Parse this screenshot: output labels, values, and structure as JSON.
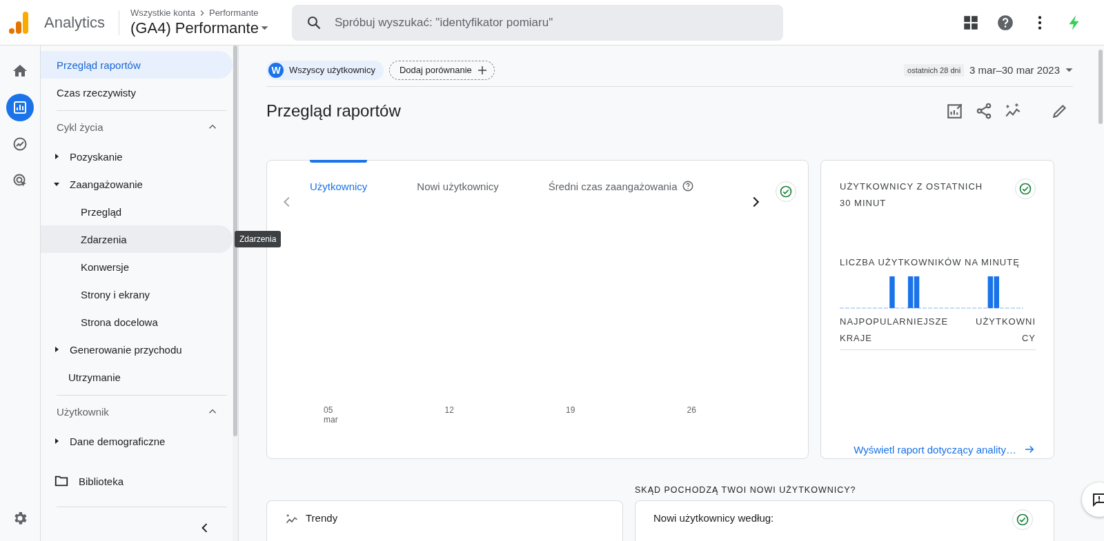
{
  "app": {
    "name": "Analytics"
  },
  "account": {
    "breadcrumb": [
      "Wszystkie konta",
      "Performante"
    ],
    "property": "(GA4) Performante"
  },
  "search": {
    "placeholder": "Spróbuj wyszukać: \"identyfikator pomiaru\""
  },
  "rail": [
    {
      "kind": "home",
      "selected": false
    },
    {
      "kind": "reports",
      "selected": true
    },
    {
      "kind": "explore",
      "selected": false
    },
    {
      "kind": "advertising",
      "selected": false
    }
  ],
  "sidebar": {
    "items": [
      {
        "label": "Przegląd raportów",
        "selected": true
      },
      {
        "label": "Czas rzeczywisty",
        "selected": false
      }
    ],
    "sections": [
      {
        "title": "Cykl życia",
        "expanded": true,
        "items": [
          {
            "label": "Pozyskanie",
            "expanded": false,
            "selected": false,
            "hovered": false
          },
          {
            "label": "Zaangażowanie",
            "expanded": true,
            "selected": false,
            "hovered": false,
            "children": [
              {
                "label": "Przegląd",
                "selected": false,
                "hovered": false
              },
              {
                "label": "Zdarzenia",
                "selected": false,
                "hovered": true,
                "tooltip": "Zdarzenia"
              },
              {
                "label": "Konwersje",
                "selected": false,
                "hovered": false
              },
              {
                "label": "Strony i ekrany",
                "selected": false,
                "hovered": false
              },
              {
                "label": "Strona docelowa",
                "selected": false,
                "hovered": false
              }
            ]
          },
          {
            "label": "Generowanie przychodu",
            "expanded": false,
            "selected": false,
            "hovered": false
          },
          {
            "label": "Utrzymanie",
            "selected": false,
            "hovered": false
          }
        ]
      },
      {
        "title": "Użytkownik",
        "expanded": true,
        "items": [
          {
            "label": "Dane demograficzne",
            "expanded": false,
            "selected": false,
            "hovered": false
          }
        ]
      }
    ],
    "library": {
      "label": "Biblioteka"
    }
  },
  "filters": {
    "segment": {
      "badge": "W",
      "label": "Wszyscy użytkownicy"
    },
    "compare": "Dodaj porównanie"
  },
  "date_range": {
    "preset": "ostatnich 28 dni",
    "range": "3 mar–30 mar 2023"
  },
  "page_title": "Przegląd raportów",
  "metrics_card": {
    "tabs": [
      {
        "label": "Użytkownicy",
        "selected": true,
        "help": false
      },
      {
        "label": "Nowi użytkownicy",
        "selected": false,
        "help": false
      },
      {
        "label": "Średni czas zaangażowania",
        "selected": false,
        "help": true
      }
    ],
    "x_labels": [
      {
        "day": "05",
        "month": "mar"
      },
      {
        "day": "12"
      },
      {
        "day": "19"
      },
      {
        "day": "26"
      }
    ]
  },
  "realtime_card": {
    "title": "UŻYTKOWNICY Z OSTATNICH 30 MINUT",
    "chart_title": "LICZBA UŻYTKOWNIKÓW NA MINUTĘ",
    "columns": [
      "NAJPOPULARNIEJSZE KRAJE",
      "UŻYTKOWNICY"
    ],
    "link": "Wyświetl raport dotyczący anality…"
  },
  "section_heading": "SKĄD POCHODZĄ TWOI NOWI UŻYTKOWNICY?",
  "bottom_cards": [
    {
      "kind": "trends",
      "title": "Trendy"
    },
    {
      "kind": "source",
      "title": "Nowi użytkownicy według:"
    }
  ]
}
